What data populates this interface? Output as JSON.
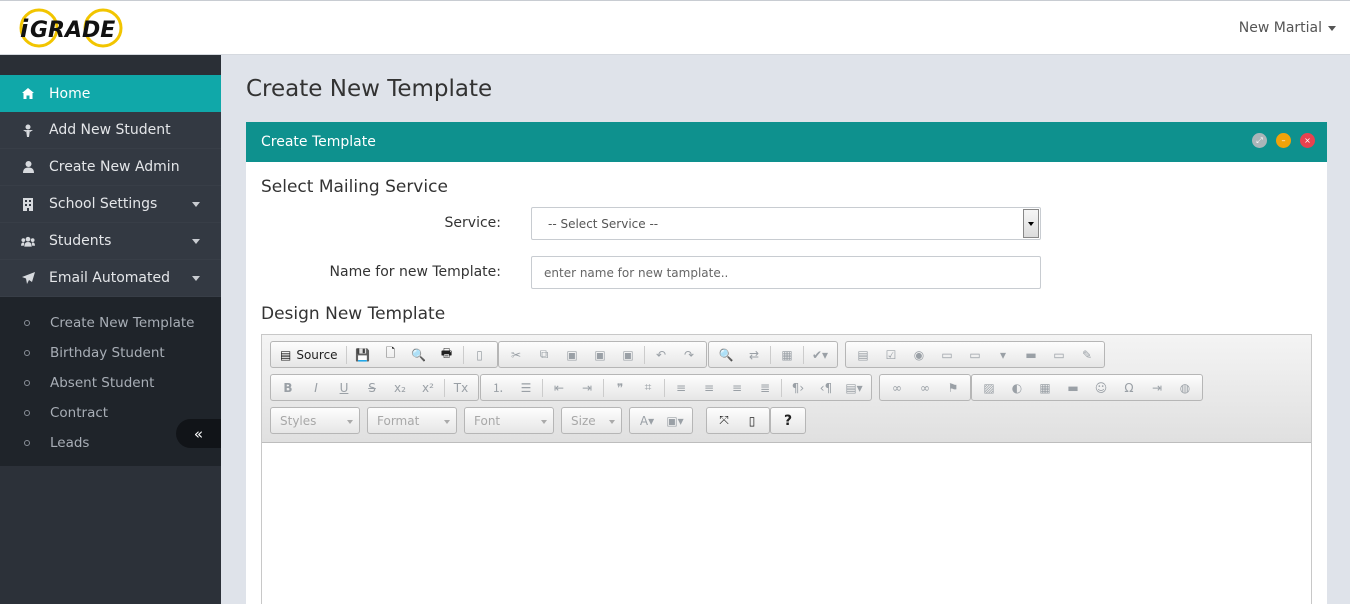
{
  "brand": {
    "logo_text": "GRADE",
    "logo_prefix": "i"
  },
  "user": {
    "name": "New Martial"
  },
  "sidebar": {
    "items": [
      {
        "label": "Home",
        "icon": "home-icon",
        "active": true
      },
      {
        "label": "Add New Student",
        "icon": "user-tie-icon"
      },
      {
        "label": "Create New Admin",
        "icon": "user-icon"
      },
      {
        "label": "School Settings",
        "icon": "building-icon",
        "dropdown": true
      },
      {
        "label": "Students",
        "icon": "users-icon",
        "dropdown": true
      },
      {
        "label": "Email Automated",
        "icon": "paper-plane-icon",
        "dropdown": true
      }
    ],
    "submenu": [
      "Create New Template",
      "Birthday Student",
      "Absent Student",
      "Contract",
      "Leads"
    ],
    "collapse_label": "«"
  },
  "page": {
    "title": "Create New Template"
  },
  "panel": {
    "title": "Create Template",
    "mailing_title": "Select Mailing Service",
    "service_label": "Service:",
    "service_selected": "-- Select Service --",
    "name_label": "Name for new Template:",
    "name_placeholder": "enter name for new tamplate..",
    "design_title": "Design New Template"
  },
  "editor": {
    "source_label": "Source",
    "combos": [
      "Styles",
      "Format",
      "Font",
      "Size"
    ],
    "help_label": "?"
  },
  "colors": {
    "accent": "#10a8a9",
    "panel_header": "#0e918e",
    "sidebar": "#333942"
  }
}
